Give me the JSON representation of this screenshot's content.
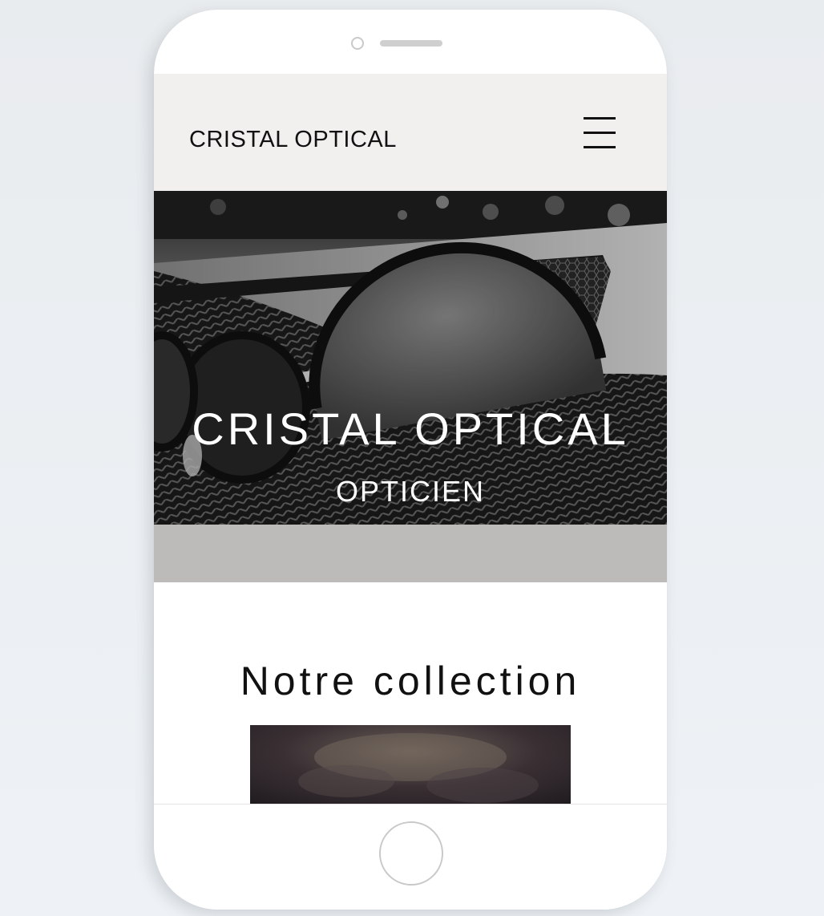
{
  "site": {
    "brand": "CRISTAL OPTICAL"
  },
  "hero": {
    "title": "CRISTAL OPTICAL",
    "subtitle": "OPTICIEN"
  },
  "collection": {
    "title": "Notre collection"
  },
  "icons": {
    "menu": "hamburger-menu-icon",
    "home": "home-button"
  },
  "colors": {
    "header_bg": "#f1f0ef",
    "band_bg": "#bcbbba",
    "text": "#111111"
  }
}
